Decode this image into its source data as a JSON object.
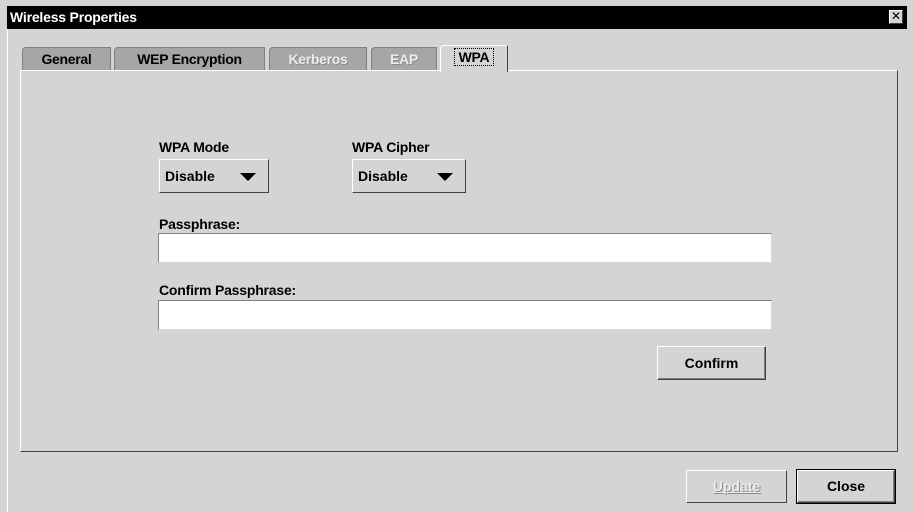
{
  "window": {
    "title": "Wireless Properties",
    "close_glyph": "✕"
  },
  "tabs": [
    {
      "label": "General",
      "enabled": true,
      "active": false
    },
    {
      "label": "WEP Encryption",
      "enabled": true,
      "active": false
    },
    {
      "label": "Kerberos",
      "enabled": false,
      "active": false
    },
    {
      "label": "EAP",
      "enabled": false,
      "active": false
    },
    {
      "label": "WPA",
      "enabled": true,
      "active": true
    }
  ],
  "wpa": {
    "mode_label": "WPA Mode",
    "mode_value": "Disable",
    "cipher_label": "WPA Cipher",
    "cipher_value": "Disable",
    "passphrase_label": "Passphrase:",
    "passphrase_value": "",
    "confirm_passphrase_label": "Confirm Passphrase:",
    "confirm_passphrase_value": "",
    "confirm_button": "Confirm"
  },
  "footer": {
    "update_button": "Update",
    "update_enabled": false,
    "close_button": "Close"
  },
  "colors": {
    "background": "#d4d4d4",
    "titlebar": "#000000",
    "inactive_tab": "#a6a6a6",
    "disabled_text": "#ececec"
  }
}
